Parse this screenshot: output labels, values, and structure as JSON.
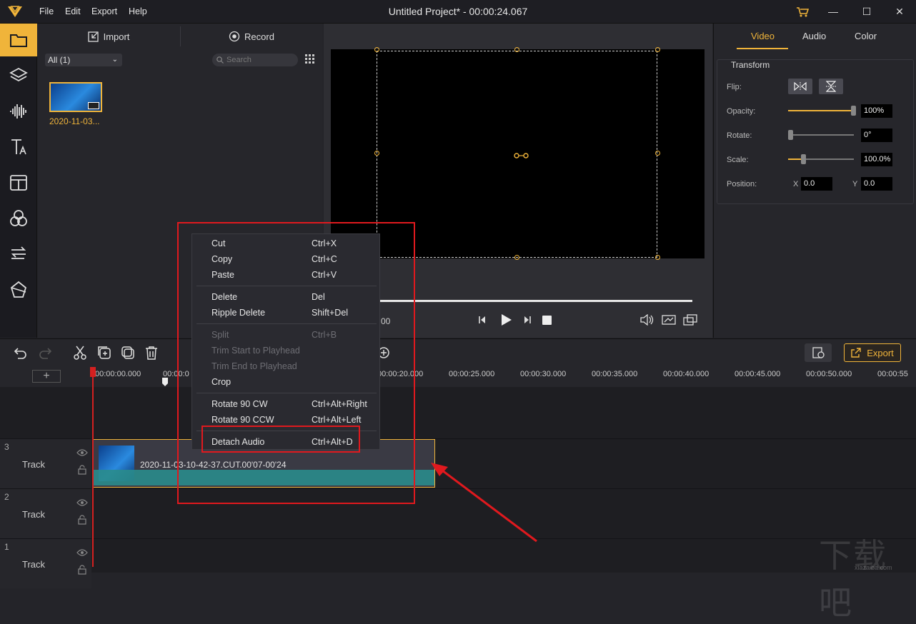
{
  "app": {
    "menu": [
      "File",
      "Edit",
      "Export",
      "Help"
    ],
    "title": "Untitled Project* - 00:00:24.067",
    "window_controls": [
      "cart-icon",
      "minimize-icon",
      "maximize-icon",
      "close-icon"
    ]
  },
  "left_toolbar": [
    "media-folder-icon",
    "layers-icon",
    "audio-wave-icon",
    "text-icon",
    "template-icon",
    "filters-icon",
    "transitions-icon",
    "elements-icon"
  ],
  "media": {
    "import_label": "Import",
    "record_label": "Record",
    "filter_value": "All (1)",
    "search_placeholder": "Search",
    "items": [
      {
        "name": "2020-11-03..."
      }
    ]
  },
  "preview": {
    "time_partial": "00",
    "controls": [
      "prev-frame-icon",
      "play-icon",
      "next-frame-icon",
      "stop-icon",
      "volume-icon",
      "snapshot-icon",
      "fullscreen-icon"
    ]
  },
  "properties": {
    "tabs": [
      "Video",
      "Audio",
      "Color"
    ],
    "active_tab": "Video",
    "section": "Transform",
    "flip_label": "Flip:",
    "opacity_label": "Opacity:",
    "opacity_value": "100%",
    "opacity_level": 1.0,
    "rotate_label": "Rotate:",
    "rotate_value": "0°",
    "rotate_level": 0.0,
    "scale_label": "Scale:",
    "scale_value": "100.0%",
    "scale_level": 0.24,
    "position_label": "Position:",
    "x_label": "X",
    "x_value": "0.0",
    "y_label": "Y",
    "y_value": "0.0"
  },
  "timeline": {
    "export_label": "Export",
    "ruler": [
      "00:00:00.000",
      "00:00:0",
      "00:00:20.000",
      "00:00:25.000",
      "00:00:30.000",
      "00:00:35.000",
      "00:00:40.000",
      "00:00:45.000",
      "00:00:50.000",
      "00:00:55"
    ],
    "tracks": [
      {
        "num": "3",
        "name": "Track"
      },
      {
        "num": "2",
        "name": "Track"
      },
      {
        "num": "1",
        "name": "Track"
      }
    ],
    "clip_label": "2020-11-03-10-42-37.CUT.00'07-00'24"
  },
  "context_menu": {
    "groups": [
      [
        {
          "label": "Cut",
          "shortcut": "Ctrl+X",
          "enabled": true
        },
        {
          "label": "Copy",
          "shortcut": "Ctrl+C",
          "enabled": true
        },
        {
          "label": "Paste",
          "shortcut": "Ctrl+V",
          "enabled": true
        }
      ],
      [
        {
          "label": "Delete",
          "shortcut": "Del",
          "enabled": true
        },
        {
          "label": "Ripple Delete",
          "shortcut": "Shift+Del",
          "enabled": true
        }
      ],
      [
        {
          "label": "Split",
          "shortcut": "Ctrl+B",
          "enabled": false
        },
        {
          "label": "Trim Start to Playhead",
          "shortcut": "",
          "enabled": false
        },
        {
          "label": "Trim End to Playhead",
          "shortcut": "",
          "enabled": false
        },
        {
          "label": "Crop",
          "shortcut": "",
          "enabled": true
        }
      ],
      [
        {
          "label": "Rotate 90 CW",
          "shortcut": "Ctrl+Alt+Right",
          "enabled": true
        },
        {
          "label": "Rotate 90 CCW",
          "shortcut": "Ctrl+Alt+Left",
          "enabled": true
        }
      ],
      [
        {
          "label": "Detach Audio",
          "shortcut": "Ctrl+Alt+D",
          "enabled": true
        }
      ]
    ]
  },
  "watermark": "xiazaiba.com",
  "colors": {
    "accent": "#f0b43a",
    "annotation": "#e0191e",
    "clip_audio": "#2a8c8c"
  }
}
